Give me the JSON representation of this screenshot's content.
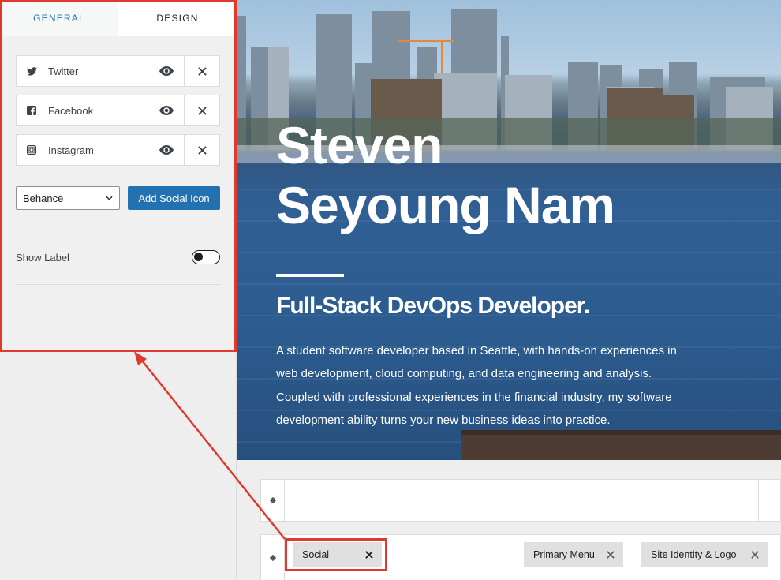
{
  "panel": {
    "tabs": [
      {
        "label": "General"
      },
      {
        "label": "Design"
      }
    ],
    "social_items": [
      {
        "label": "Twitter",
        "icon": "twitter-icon"
      },
      {
        "label": "Facebook",
        "icon": "facebook-icon"
      },
      {
        "label": "Instagram",
        "icon": "instagram-icon"
      }
    ],
    "select_value": "Behance",
    "add_button": "Add Social Icon",
    "show_label": "Show Label",
    "show_label_enabled": false
  },
  "hero": {
    "name_line1": "Steven",
    "name_line2": "Seyoung Nam",
    "subtitle": "Full-Stack DevOps Developer.",
    "description": "A student software developer based in Seattle, with hands-on experiences in web development, cloud computing, and data engineering and analysis. Coupled with professional experiences in the financial industry, my software development ability turns your new business ideas into practice."
  },
  "builder": {
    "chips": [
      {
        "label": "Social",
        "highlighted": true
      },
      {
        "label": "Primary Menu"
      },
      {
        "label": "Site Identity & Logo"
      }
    ]
  },
  "colors": {
    "accent": "#2271b1",
    "highlight": "#e03a2f",
    "panel_bg": "#eeeeee"
  }
}
